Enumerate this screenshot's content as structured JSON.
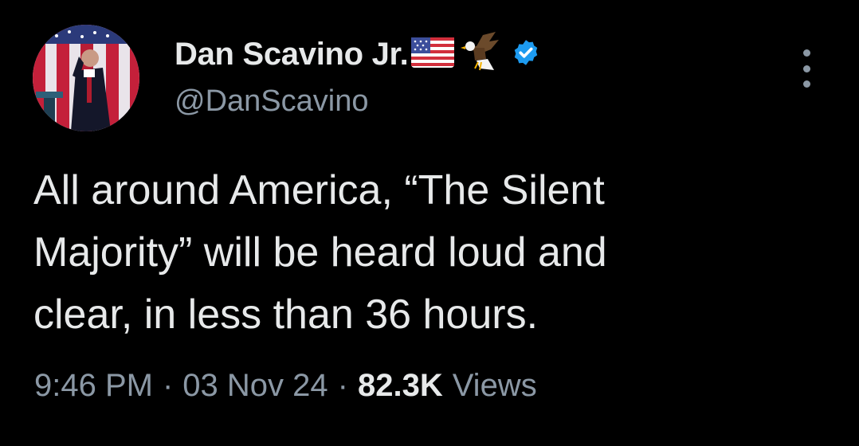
{
  "author": {
    "display_name": "Dan Scavino Jr.",
    "handle": "@DanScavino",
    "name_emojis": [
      "us-flag-icon",
      "eagle-icon"
    ],
    "verified": true
  },
  "tweet": {
    "text_lines": [
      "All around America, “The Silent",
      "Majority” will be heard loud and",
      "clear, in less than 36 hours."
    ]
  },
  "meta": {
    "time": "9:46 PM",
    "separator": "·",
    "date": "03 Nov 24",
    "views_count": "82.3K",
    "views_label": "Views"
  },
  "colors": {
    "background": "#000000",
    "primary_text": "#e7e9ea",
    "secondary_text": "#8b98a5",
    "verified_badge": "#1d9bf0"
  }
}
